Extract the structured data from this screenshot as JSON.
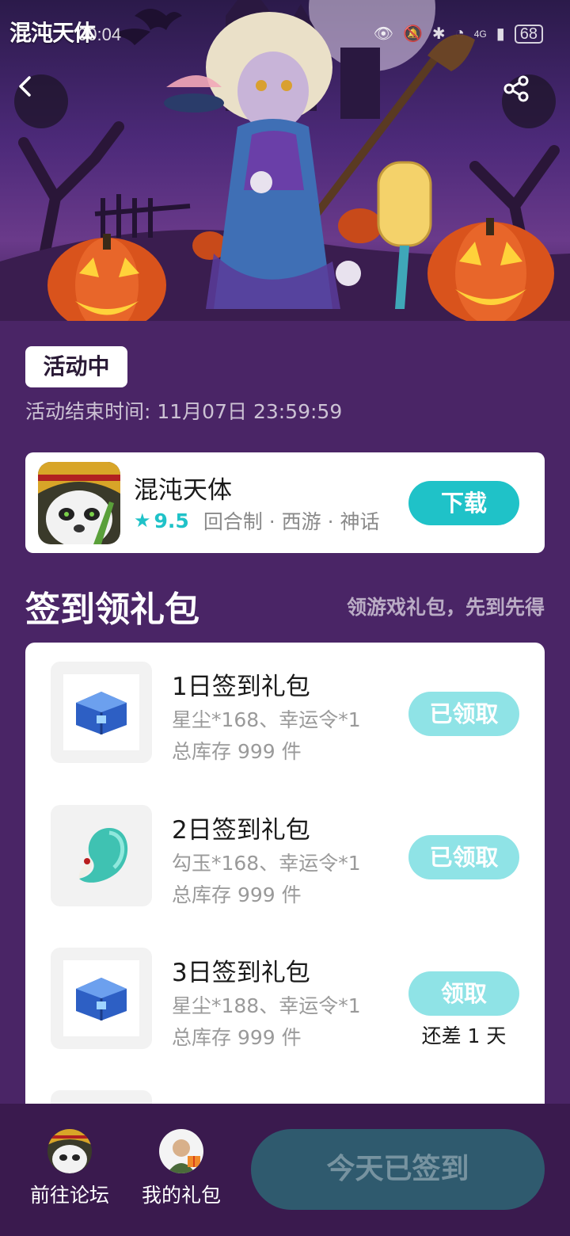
{
  "hero": {
    "logo_text": "混沌天体",
    "status_time": "00:04",
    "status_network": "4G",
    "battery": "68"
  },
  "activity": {
    "badge": "活动中",
    "end_time": "活动结束时间: 11月07日 23:59:59"
  },
  "game": {
    "name": "混沌天体",
    "rating": "9.5",
    "tags": "回合制 · 西游 · 神话",
    "download_label": "下载"
  },
  "section": {
    "title": "签到领礼包",
    "subtitle": "领游戏礼包，先到先得"
  },
  "gifts": [
    {
      "title": "1日签到礼包",
      "desc": "星尘*168、幸运令*1",
      "stock": "总库存 999 件",
      "button": "已领取",
      "icon": "blue-chest-icon"
    },
    {
      "title": "2日签到礼包",
      "desc": "勾玉*168、幸运令*1",
      "stock": "总库存 999 件",
      "button": "已领取",
      "icon": "jade-magatama-icon"
    },
    {
      "title": "3日签到礼包",
      "desc": "星尘*188、幸运令*1",
      "stock": "总库存 999 件",
      "button": "领取",
      "remaining": "还差 1 天",
      "icon": "blue-chest-icon"
    }
  ],
  "bottom": {
    "forum_label": "前往论坛",
    "mygift_label": "我的礼包",
    "checkin_label": "今天已签到"
  },
  "colors": {
    "background": "#4a2566",
    "accent": "#1fc2c8",
    "claimed_button": "#8fe3e6",
    "checkin_disabled": "#2f5a6e"
  }
}
